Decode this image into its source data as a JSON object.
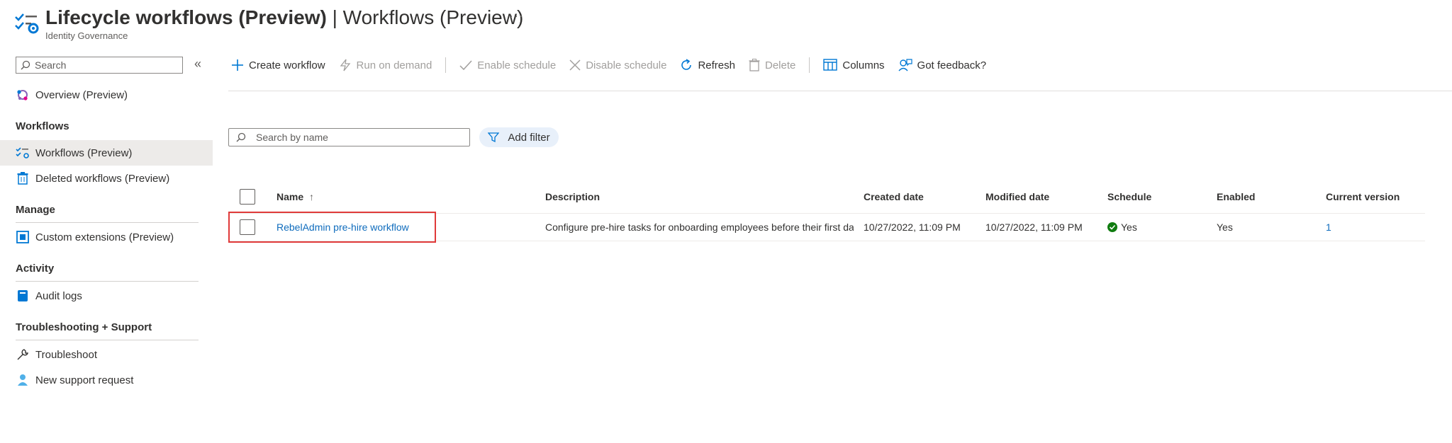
{
  "header": {
    "title_bold": "Lifecycle workflows (Preview)",
    "title_separator": " | ",
    "title_rest": "Workflows (Preview)",
    "subtitle": "Identity Governance",
    "more_label": "···",
    "icon": "workflow-settings-icon"
  },
  "sidebar": {
    "search_placeholder": "Search",
    "collapse_label": "«",
    "overview": {
      "label": "Overview (Preview)",
      "icon": "overview-icon"
    },
    "sections": [
      {
        "title": "Workflows",
        "items": [
          {
            "label": "Workflows (Preview)",
            "icon": "workflows-icon",
            "active": true
          },
          {
            "label": "Deleted workflows (Preview)",
            "icon": "trash-icon"
          }
        ]
      },
      {
        "title": "Manage",
        "items": [
          {
            "label": "Custom extensions (Preview)",
            "icon": "extensions-icon"
          }
        ]
      },
      {
        "title": "Activity",
        "items": [
          {
            "label": "Audit logs",
            "icon": "audit-logs-icon"
          }
        ]
      },
      {
        "title": "Troubleshooting + Support",
        "items": [
          {
            "label": "Troubleshoot",
            "icon": "wrench-icon"
          },
          {
            "label": "New support request",
            "icon": "support-person-icon"
          }
        ]
      }
    ]
  },
  "toolbar": {
    "create": "Create workflow",
    "run": "Run on demand",
    "enable": "Enable schedule",
    "disable": "Disable schedule",
    "refresh": "Refresh",
    "delete": "Delete",
    "columns": "Columns",
    "feedback": "Got feedback?"
  },
  "filters": {
    "search_placeholder": "Search by name",
    "add_filter": "Add filter"
  },
  "table": {
    "headers": {
      "name": "Name",
      "sort_indicator": "↑",
      "description": "Description",
      "created": "Created date",
      "modified": "Modified date",
      "schedule": "Schedule",
      "enabled": "Enabled",
      "version": "Current version"
    },
    "rows": [
      {
        "name": "RebelAdmin pre-hire workflow",
        "description": "Configure pre-hire tasks for onboarding employees before their first day",
        "created": "10/27/2022, 11:09 PM",
        "modified": "10/27/2022, 11:09 PM",
        "schedule": "Yes",
        "enabled": "Yes",
        "version": "1"
      }
    ]
  },
  "colors": {
    "link": "#0f6cbd",
    "highlight": "#e03a3a",
    "success": "#107c10",
    "active_nav": "#edebe9"
  }
}
